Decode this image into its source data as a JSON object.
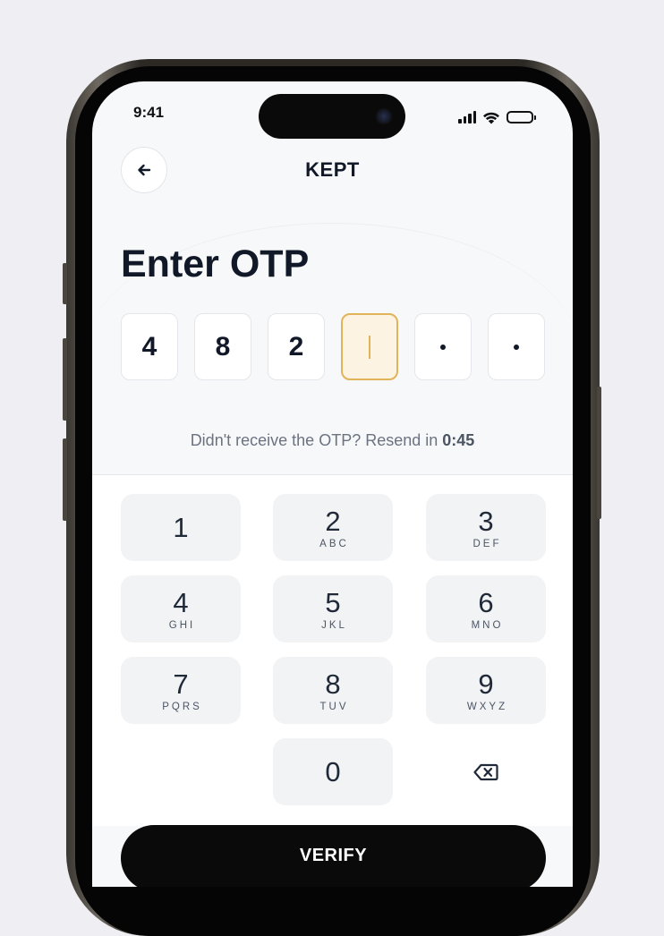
{
  "status_bar": {
    "time": "9:41"
  },
  "header": {
    "title": "KEPT"
  },
  "heading": "Enter OTP",
  "otp": {
    "digits": [
      "4",
      "8",
      "2",
      "",
      "",
      ""
    ],
    "active_index": 3
  },
  "resend": {
    "prefix": "Didn't receive the OTP? Resend in",
    "countdown": "0:45"
  },
  "keypad": {
    "keys": [
      {
        "num": "1",
        "letters": ""
      },
      {
        "num": "2",
        "letters": "ABC"
      },
      {
        "num": "3",
        "letters": "DEF"
      },
      {
        "num": "4",
        "letters": "GHI"
      },
      {
        "num": "5",
        "letters": "JKL"
      },
      {
        "num": "6",
        "letters": "MNO"
      },
      {
        "num": "7",
        "letters": "PQRS"
      },
      {
        "num": "8",
        "letters": "TUV"
      },
      {
        "num": "9",
        "letters": "WXYZ"
      },
      {
        "num": "0",
        "letters": ""
      }
    ],
    "backspace_icon": "backspace-icon"
  },
  "verify_button": {
    "label": "VERIFY"
  },
  "colors": {
    "accent": "#e2b45a",
    "active_fill": "#fdf3e2",
    "primary": "#0a0a0a",
    "text": "#111827"
  }
}
